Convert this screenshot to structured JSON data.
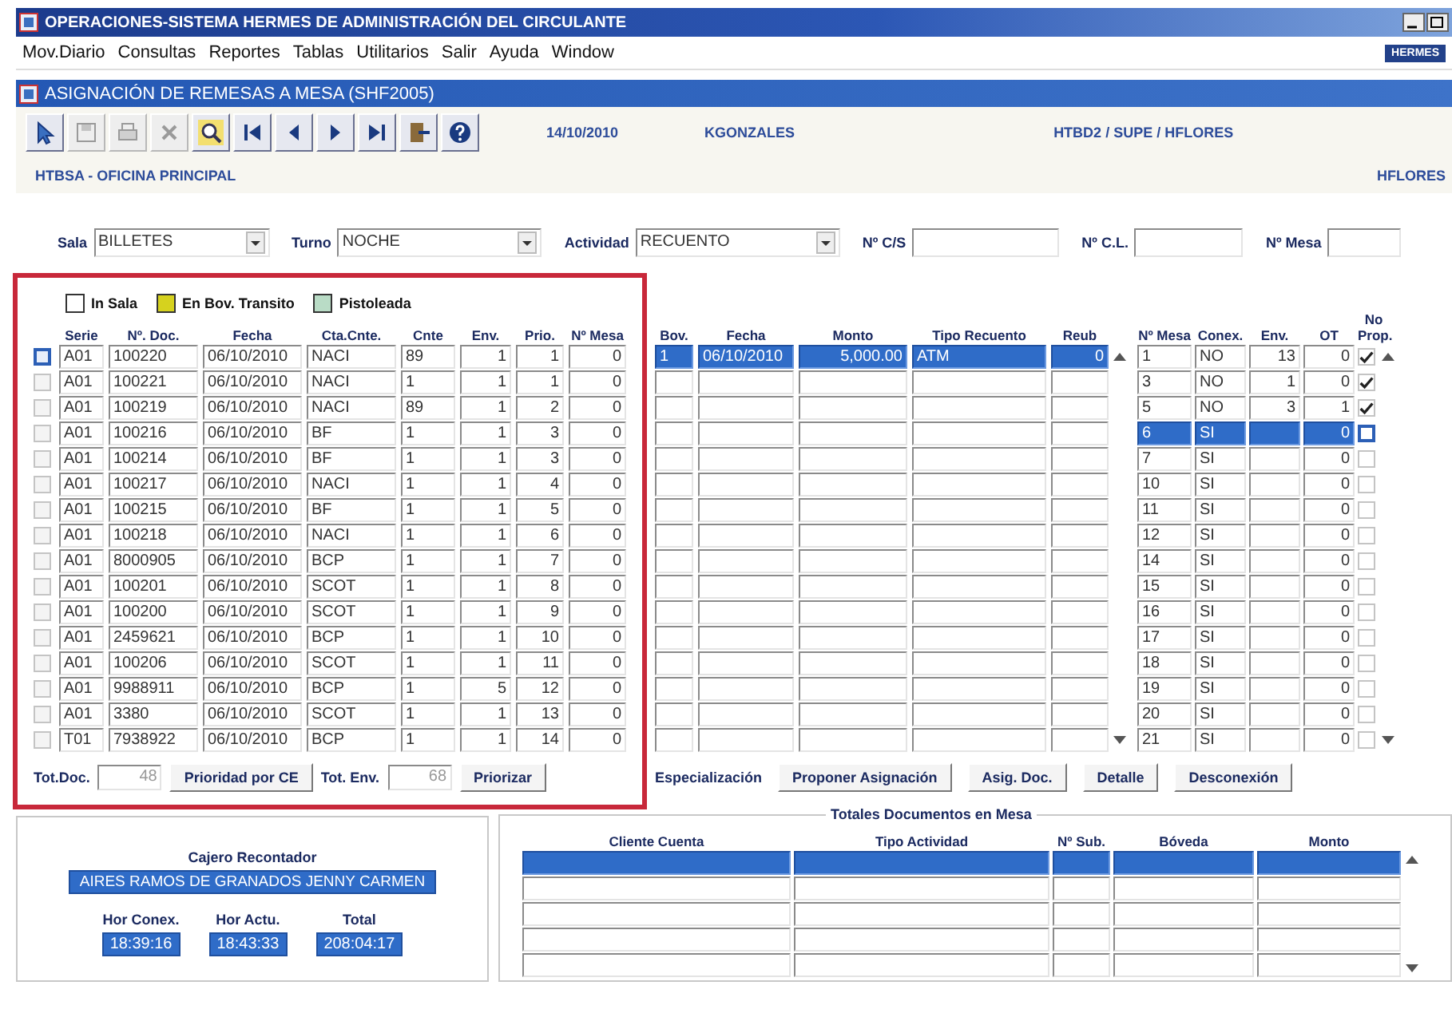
{
  "window": {
    "title": "OPERACIONES-SISTEMA HERMES DE ADMINISTRACIÓN DEL CIRCULANTE"
  },
  "menu": {
    "items": [
      "Mov.Diario",
      "Consultas",
      "Reportes",
      "Tablas",
      "Utilitarios",
      "Salir",
      "Ayuda",
      "Window"
    ],
    "badge": "HERMES"
  },
  "form": {
    "title": "ASIGNACIÓN DE REMESAS A MESA (SHF2005)"
  },
  "toolbar": {
    "buttons": [
      {
        "kind": "pointer",
        "disabled": false
      },
      {
        "kind": "save",
        "disabled": true
      },
      {
        "kind": "print",
        "disabled": true
      },
      {
        "kind": "delete",
        "disabled": true
      },
      {
        "kind": "search",
        "disabled": false
      },
      {
        "kind": "first",
        "disabled": false
      },
      {
        "kind": "prev",
        "disabled": false
      },
      {
        "kind": "next",
        "disabled": false
      },
      {
        "kind": "last",
        "disabled": false
      },
      {
        "kind": "exit",
        "disabled": false
      },
      {
        "kind": "help",
        "disabled": false
      }
    ],
    "date": "14/10/2010",
    "user": "KGONZALES",
    "connection": "HTBD2 / SUPE / HFLORES"
  },
  "header": {
    "office": "HTBSA - OFICINA PRINCIPAL",
    "user_code": "HFLORES"
  },
  "filters": [
    {
      "kind": "select",
      "label": "Sala",
      "value": "BILLETES"
    },
    {
      "kind": "select",
      "label": "Turno",
      "value": "NOCHE"
    },
    {
      "kind": "select",
      "label": "Actividad",
      "value": "RECUENTO"
    },
    {
      "kind": "text",
      "label": "Nº C/S"
    },
    {
      "kind": "text",
      "label": "Nº C.L."
    },
    {
      "kind": "text",
      "label": "Nº Mesa"
    }
  ],
  "documents": {
    "legend": [
      {
        "label": "In Sala",
        "color": "#ffffff"
      },
      {
        "label": "En Bov. Transito",
        "color": "#d6d21e"
      },
      {
        "label": "Pistoleada",
        "color": "#b9dcc6"
      }
    ],
    "columns": [
      "Serie",
      "Nº. Doc.",
      "Fecha",
      "Cta.Cnte.",
      "Cnte",
      "Env.",
      "Prio.",
      "Nº Mesa"
    ],
    "rows": [
      {
        "selected": true,
        "serie": "A01",
        "doc": "100220",
        "fecha": "06/10/2010",
        "cta": "NACI",
        "cnte": "89",
        "env": "1",
        "prio": "1",
        "mesa": "0"
      },
      {
        "selected": false,
        "serie": "A01",
        "doc": "100221",
        "fecha": "06/10/2010",
        "cta": "NACI",
        "cnte": "1",
        "env": "1",
        "prio": "1",
        "mesa": "0"
      },
      {
        "selected": false,
        "serie": "A01",
        "doc": "100219",
        "fecha": "06/10/2010",
        "cta": "NACI",
        "cnte": "89",
        "env": "1",
        "prio": "2",
        "mesa": "0"
      },
      {
        "selected": false,
        "serie": "A01",
        "doc": "100216",
        "fecha": "06/10/2010",
        "cta": "BF",
        "cnte": "1",
        "env": "1",
        "prio": "3",
        "mesa": "0"
      },
      {
        "selected": false,
        "serie": "A01",
        "doc": "100214",
        "fecha": "06/10/2010",
        "cta": "BF",
        "cnte": "1",
        "env": "1",
        "prio": "3",
        "mesa": "0"
      },
      {
        "selected": false,
        "serie": "A01",
        "doc": "100217",
        "fecha": "06/10/2010",
        "cta": "NACI",
        "cnte": "1",
        "env": "1",
        "prio": "4",
        "mesa": "0"
      },
      {
        "selected": false,
        "serie": "A01",
        "doc": "100215",
        "fecha": "06/10/2010",
        "cta": "BF",
        "cnte": "1",
        "env": "1",
        "prio": "5",
        "mesa": "0"
      },
      {
        "selected": false,
        "serie": "A01",
        "doc": "100218",
        "fecha": "06/10/2010",
        "cta": "NACI",
        "cnte": "1",
        "env": "1",
        "prio": "6",
        "mesa": "0"
      },
      {
        "selected": false,
        "serie": "A01",
        "doc": "8000905",
        "fecha": "06/10/2010",
        "cta": "BCP",
        "cnte": "1",
        "env": "1",
        "prio": "7",
        "mesa": "0"
      },
      {
        "selected": false,
        "serie": "A01",
        "doc": "100201",
        "fecha": "06/10/2010",
        "cta": "SCOT",
        "cnte": "1",
        "env": "1",
        "prio": "8",
        "mesa": "0"
      },
      {
        "selected": false,
        "serie": "A01",
        "doc": "100200",
        "fecha": "06/10/2010",
        "cta": "SCOT",
        "cnte": "1",
        "env": "1",
        "prio": "9",
        "mesa": "0"
      },
      {
        "selected": false,
        "serie": "A01",
        "doc": "2459621",
        "fecha": "06/10/2010",
        "cta": "BCP",
        "cnte": "1",
        "env": "1",
        "prio": "10",
        "mesa": "0"
      },
      {
        "selected": false,
        "serie": "A01",
        "doc": "100206",
        "fecha": "06/10/2010",
        "cta": "SCOT",
        "cnte": "1",
        "env": "1",
        "prio": "11",
        "mesa": "0"
      },
      {
        "selected": false,
        "serie": "A01",
        "doc": "9988911",
        "fecha": "06/10/2010",
        "cta": "BCP",
        "cnte": "1",
        "env": "5",
        "prio": "12",
        "mesa": "0"
      },
      {
        "selected": false,
        "serie": "A01",
        "doc": "3380",
        "fecha": "06/10/2010",
        "cta": "SCOT",
        "cnte": "1",
        "env": "1",
        "prio": "13",
        "mesa": "0"
      },
      {
        "selected": false,
        "serie": "T01",
        "doc": "7938922",
        "fecha": "06/10/2010",
        "cta": "BCP",
        "cnte": "1",
        "env": "1",
        "prio": "14",
        "mesa": "0"
      }
    ],
    "footer": [
      {
        "kind": "label",
        "text": "Tot.Doc."
      },
      {
        "kind": "field",
        "value": "48"
      },
      {
        "kind": "button",
        "text": "Prioridad por CE"
      },
      {
        "kind": "label",
        "text": "Tot. Env."
      },
      {
        "kind": "field",
        "value": "68"
      },
      {
        "kind": "button",
        "text": "Priorizar"
      }
    ]
  },
  "remesas": {
    "columns": [
      "Bov.",
      "Fecha",
      "Monto",
      "Tipo Recuento",
      "Reub"
    ],
    "rows": [
      {
        "selected": true,
        "bov": "1",
        "fecha": "06/10/2010",
        "monto": "5,000.00",
        "tipo": "ATM",
        "reub": "0"
      },
      {
        "selected": false
      },
      {
        "selected": false
      },
      {
        "selected": false
      },
      {
        "selected": false
      },
      {
        "selected": false
      },
      {
        "selected": false
      },
      {
        "selected": false
      },
      {
        "selected": false
      },
      {
        "selected": false
      },
      {
        "selected": false
      },
      {
        "selected": false
      },
      {
        "selected": false
      },
      {
        "selected": false
      },
      {
        "selected": false
      },
      {
        "selected": false
      }
    ]
  },
  "mesas": {
    "columns": [
      "Nº Mesa",
      "Conex.",
      "Env.",
      "OT",
      "No Prop."
    ],
    "rows": [
      {
        "selected": false,
        "mesa": "1",
        "conex": "NO",
        "env": "13",
        "ot": "0",
        "no_prop": true
      },
      {
        "selected": false,
        "mesa": "3",
        "conex": "NO",
        "env": "1",
        "ot": "0",
        "no_prop": true
      },
      {
        "selected": false,
        "mesa": "5",
        "conex": "NO",
        "env": "3",
        "ot": "1",
        "no_prop": true
      },
      {
        "selected": true,
        "mesa": "6",
        "conex": "SI",
        "ot": "0",
        "no_prop": false
      },
      {
        "selected": false,
        "mesa": "7",
        "conex": "SI",
        "ot": "0",
        "no_prop": false
      },
      {
        "selected": false,
        "mesa": "10",
        "conex": "SI",
        "ot": "0",
        "no_prop": false
      },
      {
        "selected": false,
        "mesa": "11",
        "conex": "SI",
        "ot": "0",
        "no_prop": false
      },
      {
        "selected": false,
        "mesa": "12",
        "conex": "SI",
        "ot": "0",
        "no_prop": false
      },
      {
        "selected": false,
        "mesa": "14",
        "conex": "SI",
        "ot": "0",
        "no_prop": false
      },
      {
        "selected": false,
        "mesa": "15",
        "conex": "SI",
        "ot": "0",
        "no_prop": false
      },
      {
        "selected": false,
        "mesa": "16",
        "conex": "SI",
        "ot": "0",
        "no_prop": false
      },
      {
        "selected": false,
        "mesa": "17",
        "conex": "SI",
        "ot": "0",
        "no_prop": false
      },
      {
        "selected": false,
        "mesa": "18",
        "conex": "SI",
        "ot": "0",
        "no_prop": false
      },
      {
        "selected": false,
        "mesa": "19",
        "conex": "SI",
        "ot": "0",
        "no_prop": false
      },
      {
        "selected": false,
        "mesa": "20",
        "conex": "SI",
        "ot": "0",
        "no_prop": false
      },
      {
        "selected": false,
        "mesa": "21",
        "conex": "SI",
        "ot": "0",
        "no_prop": false
      }
    ]
  },
  "actions": [
    {
      "kind": "label",
      "text": "Especialización"
    },
    {
      "kind": "button",
      "text": "Proponer Asignación"
    },
    {
      "kind": "button",
      "text": "Asig. Doc."
    },
    {
      "kind": "button",
      "text": "Detalle"
    },
    {
      "kind": "button",
      "text": "Desconexión"
    }
  ],
  "cajero": {
    "label": "Cajero Recontador",
    "name": "AIRES RAMOS DE GRANADOS JENNY CARMEN",
    "times": [
      {
        "label": "Hor Conex.",
        "value": "18:39:16"
      },
      {
        "label": "Hor Actu.",
        "value": "18:43:33"
      },
      {
        "label": "Total",
        "value": "208:04:17"
      }
    ]
  },
  "totales": {
    "title": "Totales Documentos en Mesa",
    "columns": [
      "Cliente Cuenta",
      "Tipo Actividad",
      "Nº Sub.",
      "Bóveda",
      "Monto"
    ],
    "rows": [
      {
        "selected": true
      },
      {
        "selected": false
      },
      {
        "selected": false
      },
      {
        "selected": false
      },
      {
        "selected": false
      }
    ]
  }
}
